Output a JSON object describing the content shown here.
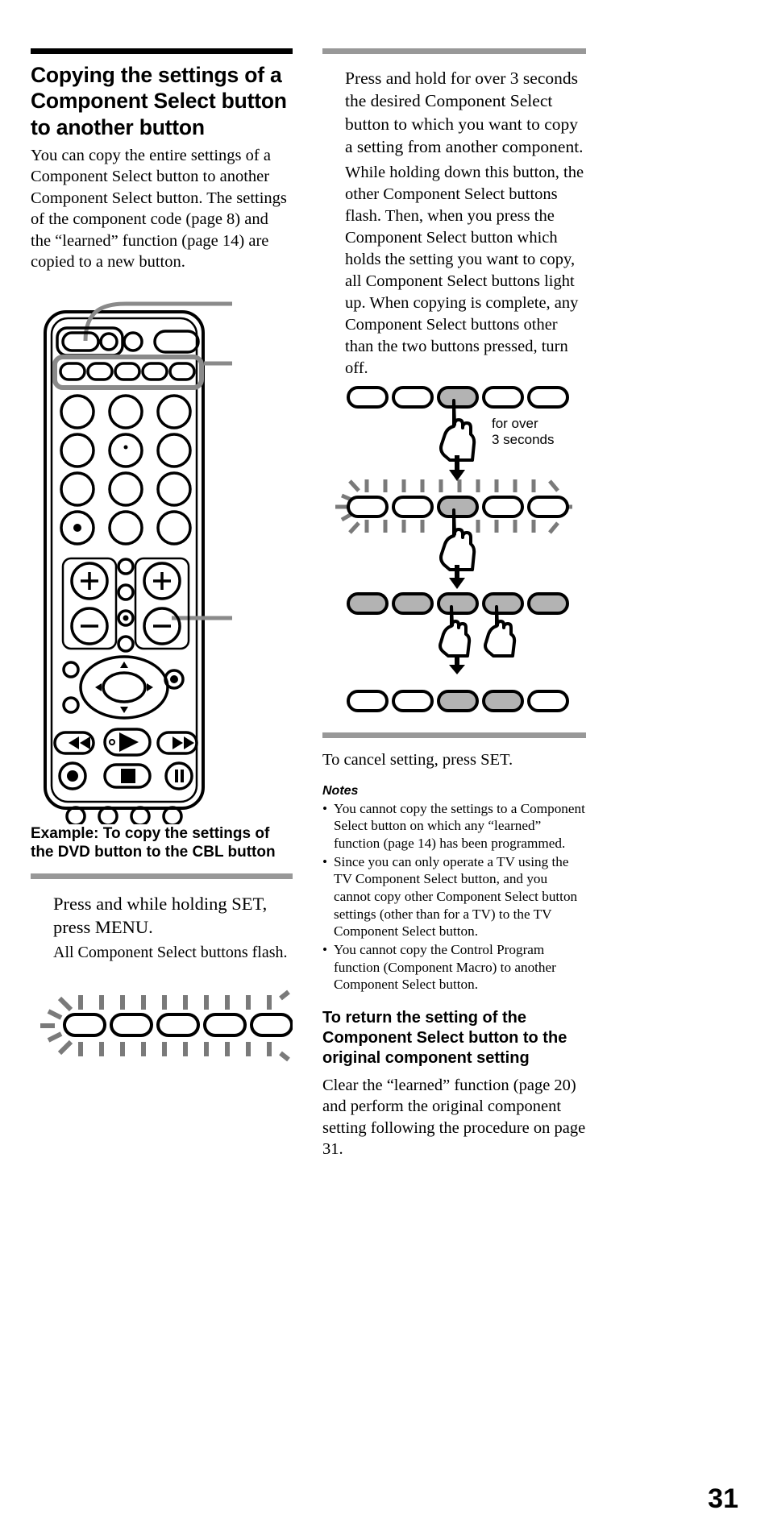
{
  "page": {
    "number": "31"
  },
  "left": {
    "section_title": "Copying the settings of a Component Select button to another button",
    "intro": "You can copy the entire settings of a Component Select button to another Component Select button. The settings of the component code (page 8) and the “learned” function (page 14) are copied to a new button.",
    "example_title": "Example: To copy the settings of the DVD button to the CBL button",
    "step_lead": "Press and while holding SET, press MENU.",
    "step_sub": "All Component Select buttons flash.",
    "flash_diagram": {
      "name": "all-buttons-flash",
      "button_count": 5,
      "states": [
        "off",
        "off",
        "off",
        "off",
        "off"
      ],
      "flashing": true
    },
    "remote": {
      "name": "remote-control-illustration",
      "callouts": [
        "set-button-callout",
        "component-select-row-callout",
        "menu-button-callout"
      ]
    }
  },
  "right": {
    "step1": "Press and hold for over 3 seconds the desired Component Select button to which you want to copy a setting from another component.",
    "step2": "While holding down this button, the other Component Select buttons flash.  Then, when you press the Component Select button which holds the setting you want to copy, all Component Select buttons light up. When copying is complete, any Component Select buttons other than the two buttons pressed, turn off.",
    "hold_label_line1": "for over",
    "hold_label_line2": "3 seconds",
    "cancel_text": "To cancel setting, press SET.",
    "notes_title": "Notes",
    "notes": [
      "You cannot copy the settings to a Component Select button on which any “learned” function (page 14)  has been programmed.",
      "Since you can only operate a TV using the TV Component Select button, and you cannot copy other Component Select button settings (other than for a TV) to the TV Component Select button.",
      "You cannot copy the Control Program function (Component Macro) to another Component Select button."
    ],
    "return_title": "To return the setting of the Component Select button to the original component setting",
    "return_body": "Clear the “learned” function (page 20) and perform the original component setting following the procedure on page 31.",
    "diagrams": [
      {
        "name": "step1-press-and-hold",
        "button_count": 5,
        "states": [
          "off",
          "off",
          "on",
          "off",
          "off"
        ],
        "flashing": false,
        "hand_on_index": 2
      },
      {
        "name": "step2-others-flash",
        "button_count": 5,
        "states": [
          "off",
          "off",
          "on",
          "off",
          "off"
        ],
        "flashing": true,
        "hand_on_index": 2
      },
      {
        "name": "step3-all-light-up",
        "button_count": 5,
        "states": [
          "on",
          "on",
          "on",
          "on",
          "on"
        ],
        "flashing": false,
        "hand_on_index": 2,
        "hand2_on_index": 3
      },
      {
        "name": "step4-two-remain",
        "button_count": 5,
        "states": [
          "off",
          "off",
          "on",
          "on",
          "off"
        ],
        "flashing": false
      }
    ]
  },
  "colors": {
    "rule_black": "#000000",
    "rule_gray": "#989898",
    "button_on": "#b3b3b3",
    "flash_mark": "#7a7a7a"
  }
}
